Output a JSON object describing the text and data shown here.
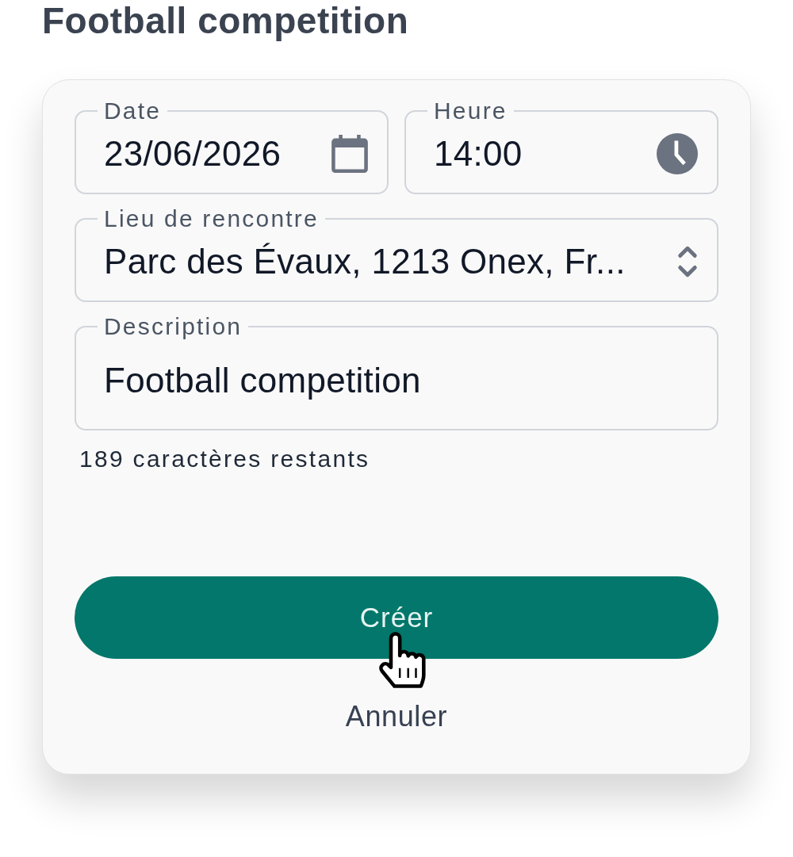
{
  "title": "Football competition",
  "form": {
    "fields": [
      {
        "kind": "date",
        "label": "Date",
        "value": "23/06/2026"
      },
      {
        "kind": "time",
        "label": "Heure",
        "value": "14:00"
      },
      {
        "kind": "select",
        "label": "Lieu de rencontre",
        "value": "Parc des Évaux, 1213 Onex, Fr..."
      },
      {
        "kind": "text",
        "label": "Description",
        "value": "Football competition"
      }
    ],
    "helper_text": "189 caractères restants",
    "buttons": [
      {
        "kind": "primary",
        "label": "Créer"
      },
      {
        "kind": "text",
        "label": "Annuler"
      }
    ]
  }
}
